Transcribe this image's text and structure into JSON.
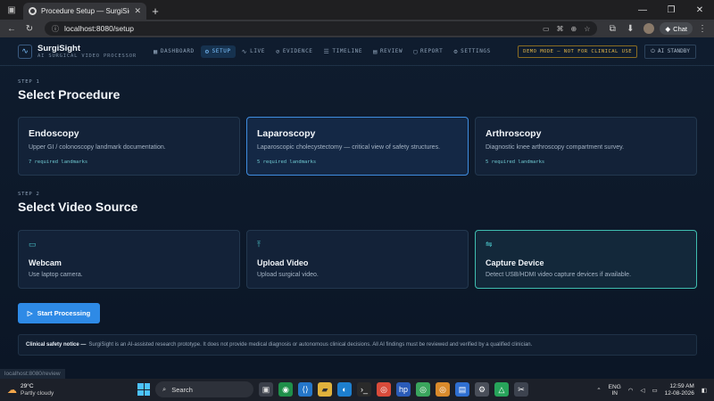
{
  "browser": {
    "tab_title": "Procedure Setup — SurgiSight",
    "url": "localhost:8080/setup",
    "chat_label": "Chat"
  },
  "app": {
    "brand": {
      "name": "SurgiSight",
      "subtitle": "AI SURGICAL VIDEO PROCESSOR"
    },
    "nav": [
      {
        "label": "DASHBOARD",
        "icon": "grid-icon",
        "active": false
      },
      {
        "label": "SETUP",
        "icon": "gear-icon",
        "active": true
      },
      {
        "label": "LIVE",
        "icon": "pulse-icon",
        "active": false
      },
      {
        "label": "EVIDENCE",
        "icon": "clip-icon",
        "active": false
      },
      {
        "label": "TIMELINE",
        "icon": "timeline-icon",
        "active": false
      },
      {
        "label": "REVIEW",
        "icon": "review-icon",
        "active": false
      },
      {
        "label": "REPORT",
        "icon": "report-icon",
        "active": false
      },
      {
        "label": "SETTINGS",
        "icon": "settings-icon",
        "active": false
      }
    ],
    "demo_badge": "DEMO MODE — NOT FOR CLINICAL USE",
    "ai_status": "AI STANDBY"
  },
  "step1": {
    "label": "STEP 1",
    "title": "Select Procedure",
    "cards": [
      {
        "title": "Endoscopy",
        "desc": "Upper GI / colonoscopy landmark documentation.",
        "meta": "7 required landmarks",
        "selected": false
      },
      {
        "title": "Laparoscopy",
        "desc": "Laparoscopic cholecystectomy — critical view of safety structures.",
        "meta": "5 required landmarks",
        "selected": true
      },
      {
        "title": "Arthroscopy",
        "desc": "Diagnostic knee arthroscopy compartment survey.",
        "meta": "5 required landmarks",
        "selected": false
      }
    ]
  },
  "step2": {
    "label": "STEP 2",
    "title": "Select Video Source",
    "cards": [
      {
        "title": "Webcam",
        "desc": "Use laptop camera.",
        "icon": "camera-icon",
        "selected": false
      },
      {
        "title": "Upload Video",
        "desc": "Upload surgical video.",
        "icon": "upload-icon",
        "selected": false
      },
      {
        "title": "Capture Device",
        "desc": "Detect USB/HDMI video capture devices if available.",
        "icon": "capture-icon",
        "selected": true
      }
    ]
  },
  "start_button": "Start Processing",
  "notice": {
    "title": "Clinical safety notice —",
    "text": "SurgiSight is an AI-assisted research prototype. It does not provide medical diagnosis or autonomous clinical decisions. All AI findings must be reviewed and verified by a qualified clinician."
  },
  "status_url": "localhost:8080/review",
  "taskbar": {
    "weather_temp": "29°C",
    "weather_cond": "Partly cloudy",
    "search_label": "Search",
    "lang_top": "ENG",
    "lang_bottom": "IN",
    "time": "12:59 AM",
    "date": "12-08-2026"
  }
}
